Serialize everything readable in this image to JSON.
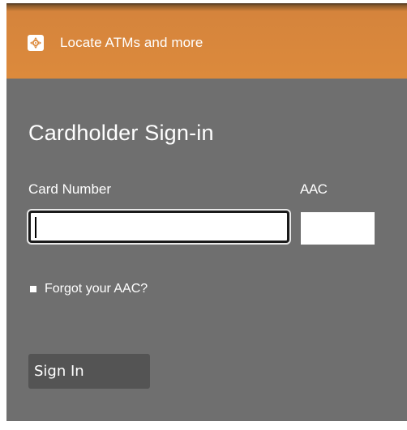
{
  "header": {
    "locate_link_label": "Locate ATMs and more",
    "locate_icon": "crosshair-locate-icon",
    "accent_color": "#dc8a3c"
  },
  "signin": {
    "title": "Cardholder Sign-in",
    "card_number_label": "Card Number",
    "card_number_value": "",
    "aac_label": "AAC",
    "aac_value": "",
    "forgot_link_label": "Forgot your AAC?",
    "submit_label": "Sign In"
  },
  "colors": {
    "panel_background": "#6f6f6f",
    "button_background": "#545454",
    "text": "#ffffff"
  }
}
